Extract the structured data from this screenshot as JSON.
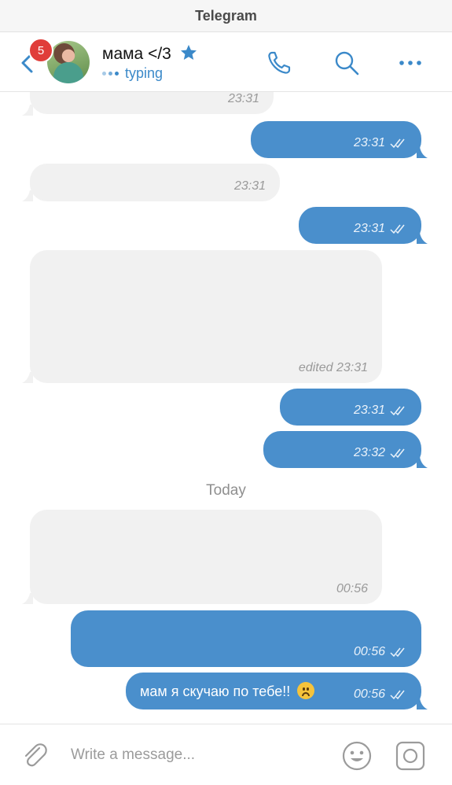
{
  "window": {
    "title": "Telegram"
  },
  "header": {
    "unread_count": "5",
    "contact_name": "мама </3",
    "status": "typing"
  },
  "chat": {
    "day_separator": "Today",
    "messages": [
      {
        "dir": "in",
        "text": "",
        "time": "23:31"
      },
      {
        "dir": "out",
        "text": "",
        "time": "23:31"
      },
      {
        "dir": "in",
        "text": "",
        "time": "23:31"
      },
      {
        "dir": "out",
        "text": "",
        "time": "23:31"
      },
      {
        "dir": "in",
        "text": "",
        "time": "edited 23:31"
      },
      {
        "dir": "out",
        "text": "",
        "time": "23:31"
      },
      {
        "dir": "out",
        "text": "",
        "time": "23:32"
      },
      {
        "dir": "in",
        "text": "",
        "time": "00:56"
      },
      {
        "dir": "out",
        "text": "",
        "time": "00:56"
      },
      {
        "dir": "out",
        "text": "мам я скучаю по тебе!!",
        "time": "00:56",
        "emoji": "frowning-face"
      }
    ]
  },
  "composer": {
    "placeholder": "Write a message..."
  },
  "colors": {
    "accent": "#3b89c9",
    "outgoing_bubble": "#4a8fcc",
    "incoming_bubble": "#f1f1f1",
    "badge": "#e03d3a"
  }
}
